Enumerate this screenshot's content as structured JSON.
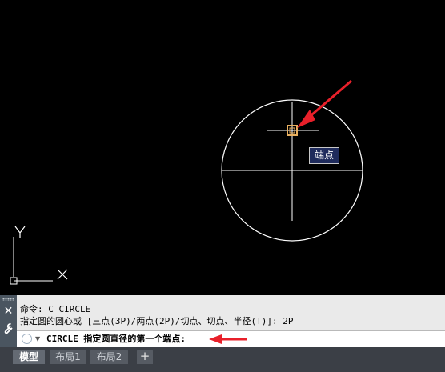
{
  "canvas": {
    "snap_tooltip": "端点",
    "ucs": {
      "x_label": "X",
      "y_label": "Y"
    }
  },
  "command_window": {
    "history": [
      "命令: C CIRCLE",
      "指定圆的圆心或 [三点(3P)/两点(2P)/切点、切点、半径(T)]: 2P"
    ],
    "close_icon": "close-icon",
    "customize_icon": "wrench-icon",
    "prompt": "CIRCLE 指定圆直径的第一个端点:"
  },
  "layout_tabs": {
    "tabs": [
      {
        "label": "模型",
        "active": true
      },
      {
        "label": "布局1",
        "active": false
      },
      {
        "label": "布局2",
        "active": false
      }
    ],
    "add_label": "+"
  },
  "colors": {
    "canvas_bg": "#000000",
    "geometry": "#ffffff",
    "snap_marker": "#e8b060",
    "annotation_arrow": "#e8202a",
    "tooltip_bg": "#1f2b5c"
  }
}
